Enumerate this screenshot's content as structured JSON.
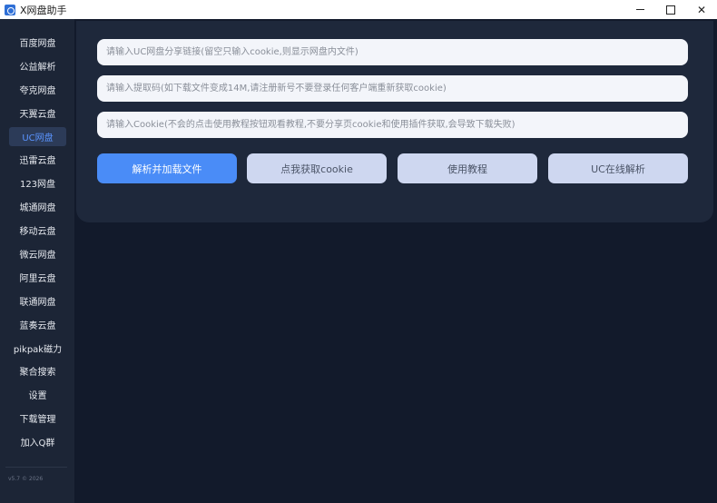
{
  "window": {
    "title": "X网盘助手",
    "minimize_glyph": "",
    "maximize_glyph": "",
    "close_glyph": "✕"
  },
  "sidebar": {
    "items": [
      {
        "label": "百度网盘",
        "active": false
      },
      {
        "label": "公益解析",
        "active": false
      },
      {
        "label": "夸克网盘",
        "active": false
      },
      {
        "label": "天翼云盘",
        "active": false
      },
      {
        "label": "UC网盘",
        "active": true
      },
      {
        "label": "迅雷云盘",
        "active": false
      },
      {
        "label": "123网盘",
        "active": false
      },
      {
        "label": "城通网盘",
        "active": false
      },
      {
        "label": "移动云盘",
        "active": false
      },
      {
        "label": "微云网盘",
        "active": false
      },
      {
        "label": "阿里云盘",
        "active": false
      },
      {
        "label": "联通网盘",
        "active": false
      },
      {
        "label": "蓝奏云盘",
        "active": false
      },
      {
        "label": "pikpak磁力",
        "active": false
      },
      {
        "label": "聚合搜索",
        "active": false
      },
      {
        "label": "设置",
        "active": false
      },
      {
        "label": "下载管理",
        "active": false
      },
      {
        "label": "加入Q群",
        "active": false
      }
    ],
    "version": "v5.7   © 2026"
  },
  "main": {
    "share_link_input": {
      "value": "",
      "placeholder": "请输入UC网盘分享链接(留空只输入cookie,则显示网盘内文件)"
    },
    "extract_code_input": {
      "value": "",
      "placeholder": "请输入提取码(如下载文件变成14M,请注册新号不要登录任何客户端重新获取cookie)"
    },
    "cookie_input": {
      "value": "",
      "placeholder": "请输入Cookie(不会的点击使用教程按钮观看教程,不要分享页cookie和使用插件获取,会导致下载失败)"
    },
    "buttons": {
      "parse": "解析并加载文件",
      "get_cookie": "点我获取cookie",
      "tutorial": "使用教程",
      "online_parse": "UC在线解析"
    }
  },
  "colors": {
    "sidebar_bg": "#1c2536",
    "content_bg": "#121a2b",
    "panel_bg": "#1e283b",
    "accent": "#4a8cf7",
    "active_nav_text": "#5a94ff",
    "secondary_button": "#ced7f0"
  }
}
